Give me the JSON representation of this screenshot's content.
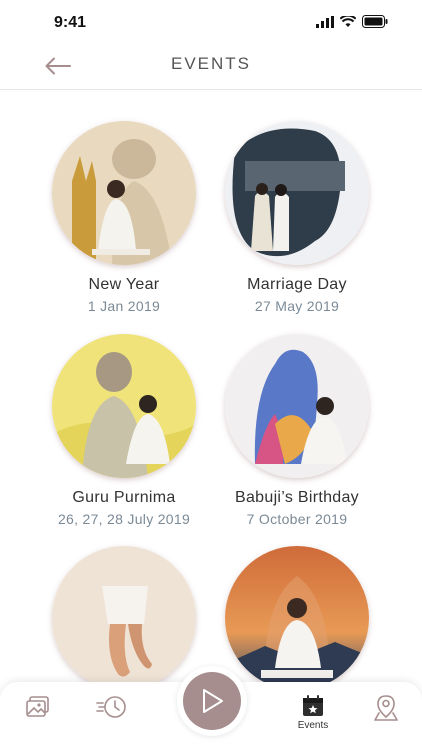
{
  "status": {
    "time": "9:41"
  },
  "header": {
    "title": "EVENTS"
  },
  "events": [
    {
      "name": "New Year",
      "date": "1 Jan 2019"
    },
    {
      "name": "Marriage Day",
      "date": "27 May 2019"
    },
    {
      "name": "Guru Purnima",
      "date": "26, 27, 28 July 2019"
    },
    {
      "name": "Babuji’s Birthday",
      "date": "7 October 2019"
    },
    {
      "name": "",
      "date": ""
    },
    {
      "name": "",
      "date": ""
    }
  ],
  "tabs": {
    "gallery_icon": "gallery-icon",
    "history_icon": "history-icon",
    "play_icon": "play-icon",
    "events_icon": "calendar-star-icon",
    "events_label": "Events",
    "location_icon": "location-pin-icon"
  },
  "colors": {
    "accent": "#a68e8e",
    "date": "#7b8a96",
    "title": "#555555"
  }
}
